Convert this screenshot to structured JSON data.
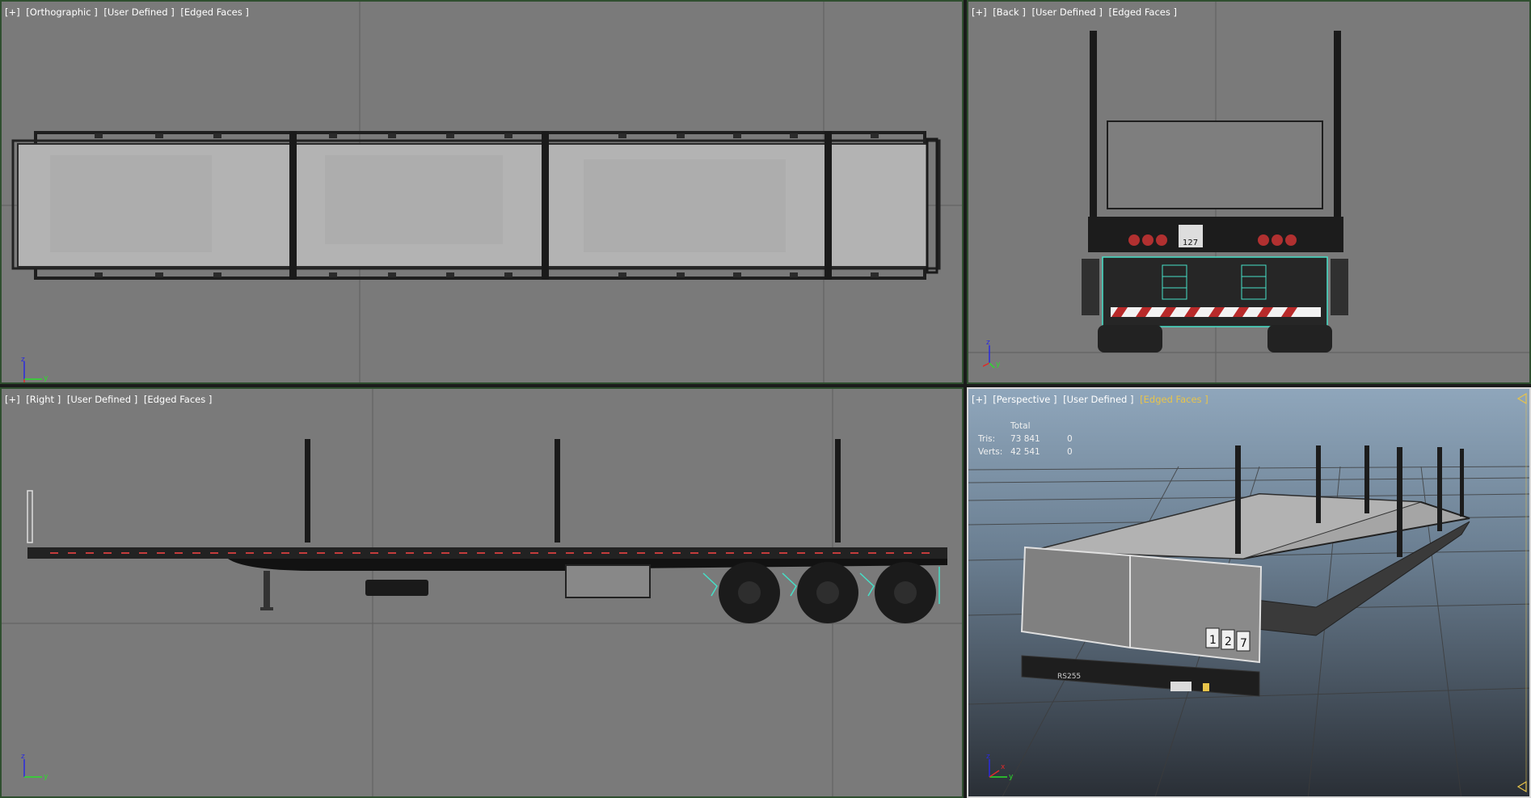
{
  "viewports": {
    "top": {
      "labels": [
        "[+]",
        "[Orthographic ]",
        "[User Defined ]",
        "[Edged Faces ]"
      ],
      "axis": {
        "a": "z",
        "b": "y"
      }
    },
    "back": {
      "labels": [
        "[+]",
        "[Back ]",
        "[User Defined ]",
        "[Edged Faces ]"
      ],
      "axis": {
        "a": "z",
        "b": "y"
      },
      "decal_text": "127"
    },
    "right": {
      "labels": [
        "[+]",
        "[Right ]",
        "[User Defined ]",
        "[Edged Faces ]"
      ],
      "axis": {
        "a": "z",
        "b": "y"
      }
    },
    "perspective": {
      "labels": [
        "[+]",
        "[Perspective ]",
        "[User Defined ]",
        "[Edged Faces ]"
      ],
      "axis": {
        "a": "z",
        "b": "y",
        "c": "x"
      },
      "stats": {
        "header": "Total",
        "tris_label": "Tris:",
        "tris_value": "73 841",
        "tris_sel": "0",
        "verts_label": "Verts:",
        "verts_value": "42 541",
        "verts_sel": "0"
      },
      "plate_digits": [
        "1",
        "2",
        "7"
      ],
      "bumper_text": "RS255"
    }
  },
  "colors": {
    "viewport_bg": "#7a7a7a",
    "inactive_border": "#2f4f2f",
    "active_border": "#d8d8d8",
    "label": "#ffffff",
    "highlight_label": "#e8c44a",
    "selection_wire": "#46e0c8",
    "grid_line": "#5a5a5a"
  }
}
